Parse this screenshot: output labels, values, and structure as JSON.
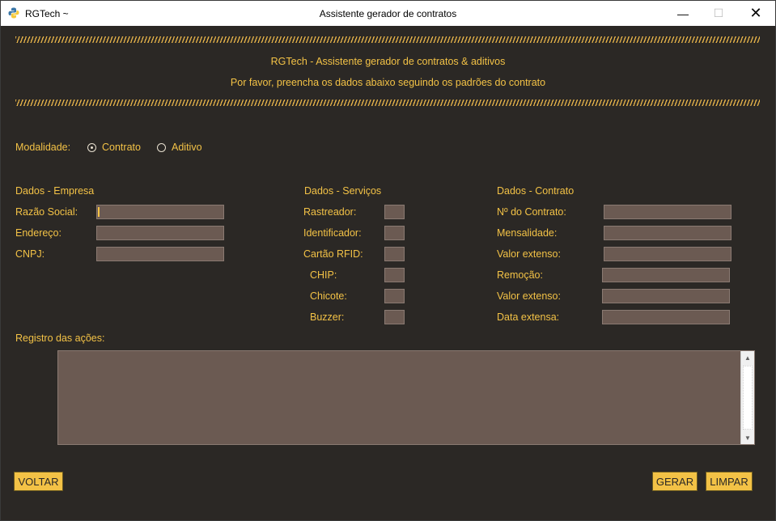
{
  "window": {
    "app_name": "RGTech ~",
    "title": "Assistente gerador de contratos",
    "controls": {
      "minimize": "—",
      "maximize": "☐",
      "close": "✕"
    }
  },
  "header": {
    "divider": "////////////////////////////////////////////////////////////////////////////////////////////////////////////////////////////////////////////////////////////////////////////////////////////////////////",
    "title": "RGTech - Assistente gerador de contratos & aditivos",
    "subtitle": "Por favor, preencha os dados abaixo seguindo os padrões do contrato"
  },
  "modalidade": {
    "label": "Modalidade:",
    "options": [
      {
        "label": "Contrato",
        "selected": true
      },
      {
        "label": "Aditivo",
        "selected": false
      }
    ]
  },
  "empresa": {
    "heading": "Dados - Empresa",
    "fields": [
      {
        "label": "Razão Social:",
        "value": ""
      },
      {
        "label": "Endereço:",
        "value": ""
      },
      {
        "label": "CNPJ:",
        "value": ""
      }
    ]
  },
  "servicos": {
    "heading": "Dados - Serviços",
    "fields": [
      {
        "label": "Rastreador:",
        "value": ""
      },
      {
        "label": "Identificador:",
        "value": ""
      },
      {
        "label": "Cartão RFID:",
        "value": ""
      },
      {
        "label": "CHIP:",
        "value": ""
      },
      {
        "label": "Chicote:",
        "value": ""
      },
      {
        "label": "Buzzer:",
        "value": ""
      }
    ]
  },
  "contrato": {
    "heading": "Dados - Contrato",
    "fields": [
      {
        "label": "Nº do Contrato:",
        "value": ""
      },
      {
        "label": "Mensalidade:",
        "value": ""
      },
      {
        "label": "Valor extenso:",
        "value": ""
      },
      {
        "label": "Remoção:",
        "value": ""
      },
      {
        "label": "Valor extenso:",
        "value": ""
      },
      {
        "label": "Data extensa:",
        "value": ""
      }
    ]
  },
  "log": {
    "label": "Registro das ações:",
    "content": ""
  },
  "buttons": {
    "back": "VOLTAR",
    "generate": "GERAR",
    "clear": "LIMPAR"
  },
  "colors": {
    "background": "#2b2825",
    "accent": "#f3c246",
    "field": "#6b5a52"
  }
}
